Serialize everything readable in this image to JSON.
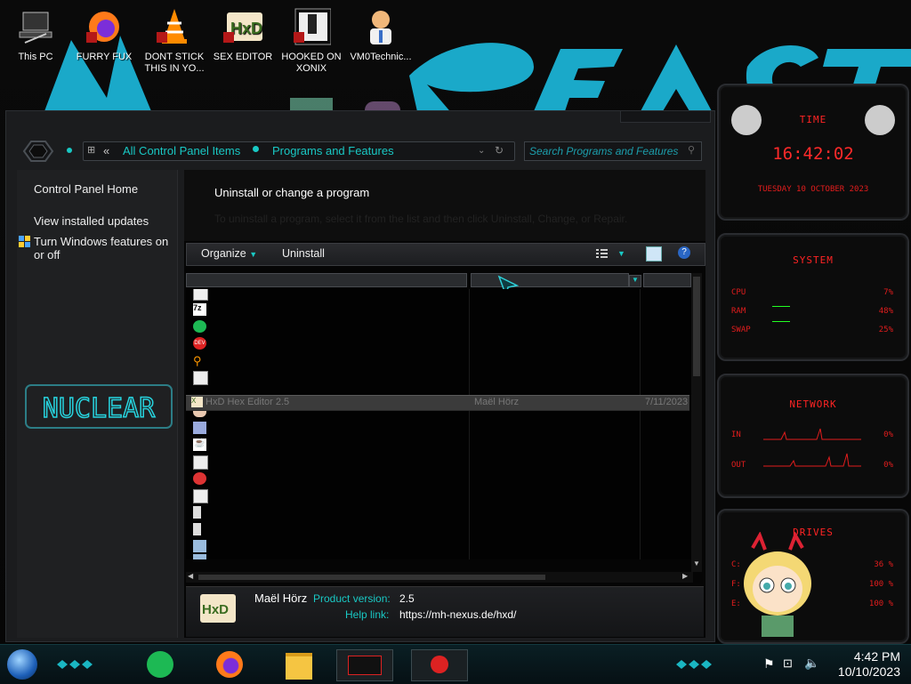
{
  "desktop": {
    "icons": [
      {
        "label": "This PC"
      },
      {
        "label": "FURRY FUX"
      },
      {
        "label": "DONT STICK THIS IN YO..."
      },
      {
        "label": "SEX EDITOR"
      },
      {
        "label": "HOOKED ON XONIX"
      },
      {
        "label": "VM0Technic..."
      }
    ]
  },
  "window": {
    "breadcrumb": [
      "All Control Panel Items",
      "Programs and Features"
    ],
    "search_placeholder": "Search Programs and Features",
    "sidebar": {
      "items": [
        {
          "label": "Control Panel Home"
        },
        {
          "label": "View installed updates"
        },
        {
          "label": "Turn Windows features on or off"
        }
      ],
      "logo": "NUCLEAR"
    },
    "header": {
      "title": "Uninstall or change a program",
      "subtitle": "To uninstall a program, select it from the list and then click Uninstall, Change, or Repair."
    },
    "toolbar": {
      "organize": "Organize",
      "uninstall": "Uninstall"
    },
    "selected_row": {
      "name": "HxD Hex Editor 2.5",
      "publisher": "Maël Hörz",
      "installed_on": "7/11/2023"
    },
    "details": {
      "publisher": "Maël Hörz",
      "version_label": "Product version:",
      "version": "2.5",
      "help_label": "Help link:",
      "help": "https://mh-nexus.de/hxd/"
    }
  },
  "gadgets": {
    "time": {
      "title": "TIME",
      "clock": "16:42:02",
      "date": "TUESDAY 10 OCTOBER 2023"
    },
    "system": {
      "title": "SYSTEM",
      "rows": [
        {
          "label": "CPU",
          "value": "7%"
        },
        {
          "label": "RAM",
          "value": "48%"
        },
        {
          "label": "SWAP",
          "value": "25%"
        }
      ]
    },
    "network": {
      "title": "NETWORK",
      "rows": [
        {
          "label": "IN",
          "value": "0%"
        },
        {
          "label": "OUT",
          "value": "0%"
        }
      ]
    },
    "drives": {
      "title": "DRIVES",
      "rows": [
        {
          "label": "C:",
          "value": "36 %"
        },
        {
          "label": "F:",
          "value": "100 %"
        },
        {
          "label": "E:",
          "value": "100 %"
        }
      ]
    }
  },
  "taskbar": {
    "time": "4:42 PM",
    "date": "10/10/2023"
  },
  "colors": {
    "accent": "#19c8c4",
    "gadget": "#e21d1d"
  }
}
